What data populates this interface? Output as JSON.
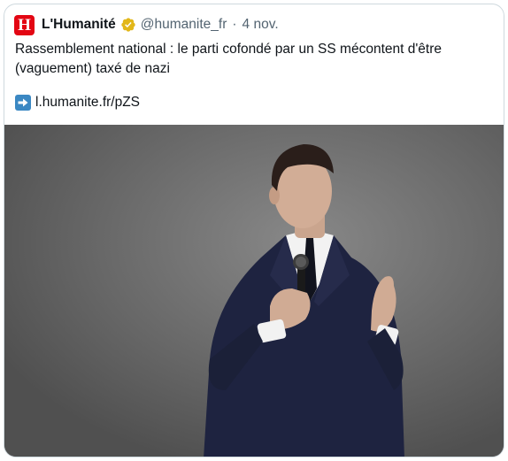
{
  "tweet": {
    "avatar_letter": "H",
    "display_name": "L'Humanité",
    "verified_icon": "verified-badge-gold",
    "handle": "@humanite_fr",
    "separator": "·",
    "date": "4 nov.",
    "text": "Rassemblement national : le parti cofondé par un SS mécontent d'être (vaguement) taxé de nazi",
    "link_icon": "right-arrow-emoji",
    "link": "l.humanite.fr/pZS"
  },
  "colors": {
    "brand_red": "#e30613",
    "verified_gold": "#e2b719",
    "link_arrow_blue": "#3b88c3",
    "muted_text": "#536471"
  }
}
